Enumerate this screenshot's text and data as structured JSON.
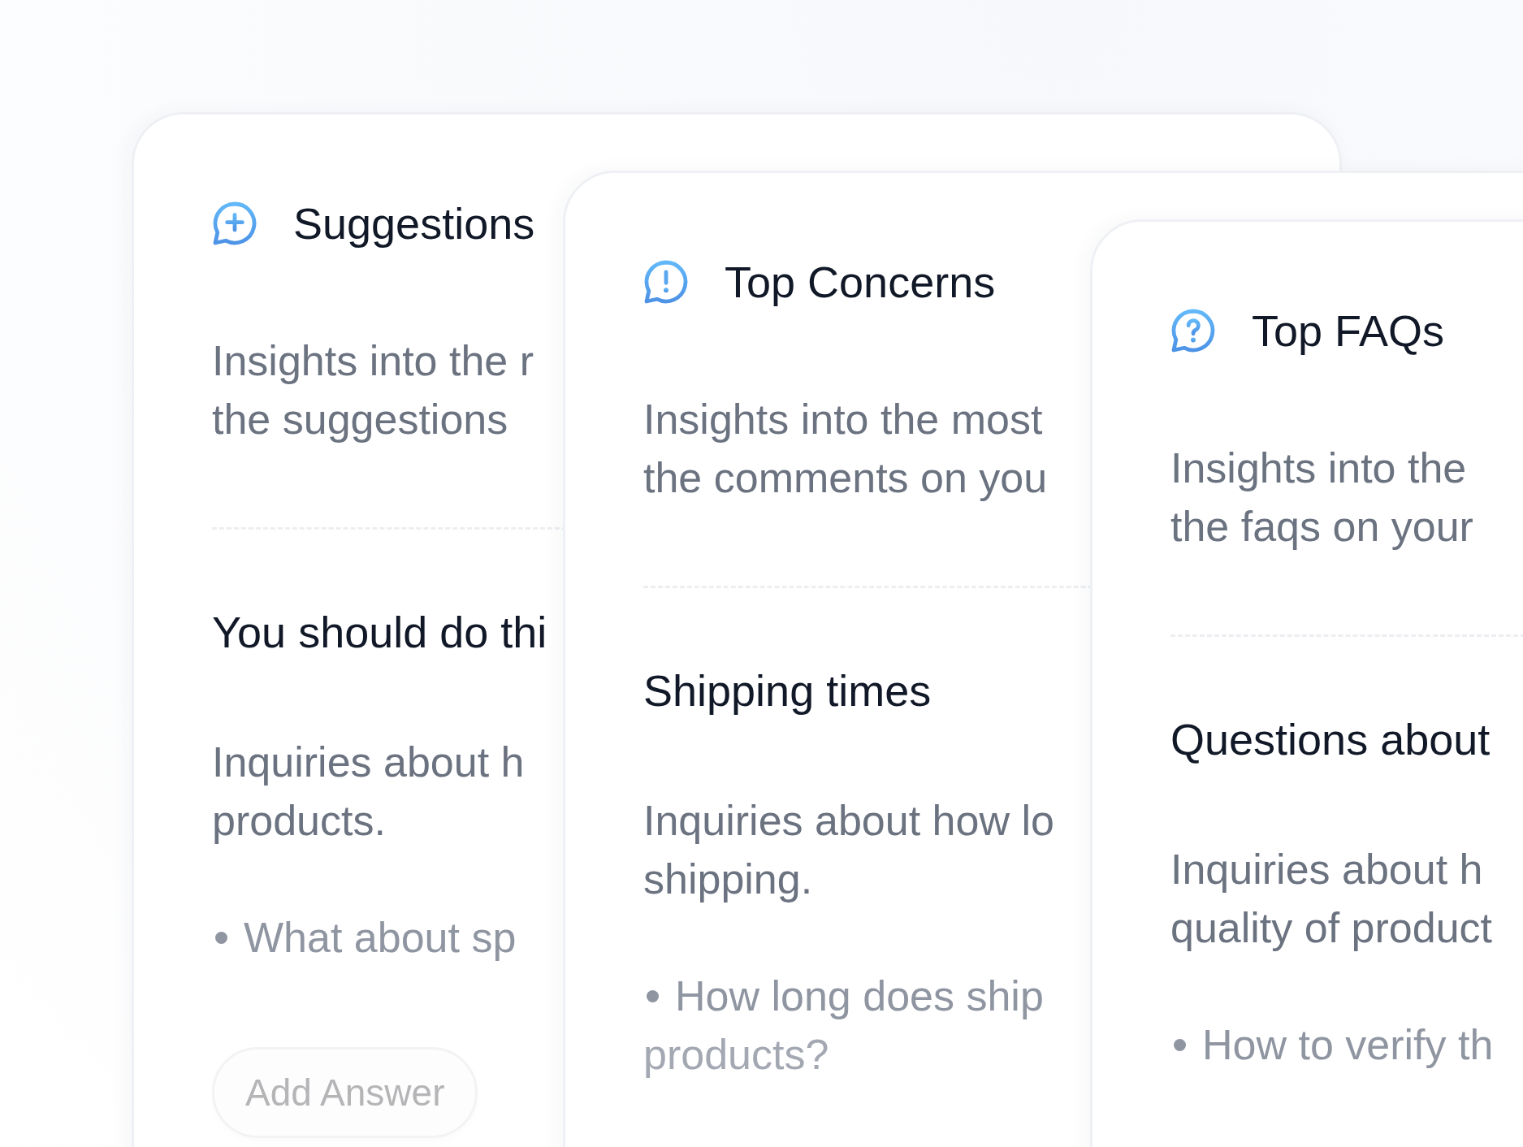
{
  "cards": [
    {
      "kind": "suggestion",
      "title": "Suggestions",
      "description": [
        "Insights into the r",
        "the suggestions"
      ],
      "heading": "You should do thi",
      "detail": [
        "Inquiries about h",
        "products."
      ],
      "bullet": [
        "What about sp"
      ],
      "button": "Add Answer"
    },
    {
      "kind": "concern",
      "title": "Top Concerns",
      "description": [
        "Insights into the most",
        "the comments on you"
      ],
      "heading": "Shipping times",
      "detail": [
        "Inquiries about how lo",
        "shipping."
      ],
      "bullet": [
        "How long does ship",
        "products?"
      ]
    },
    {
      "kind": "faq",
      "title": "Top FAQs",
      "description": [
        "Insights into the",
        "the faqs on your"
      ],
      "heading": "Questions about",
      "detail": [
        "Inquiries about h",
        "quality of product"
      ],
      "bullet": [
        "How to verify th"
      ]
    }
  ]
}
